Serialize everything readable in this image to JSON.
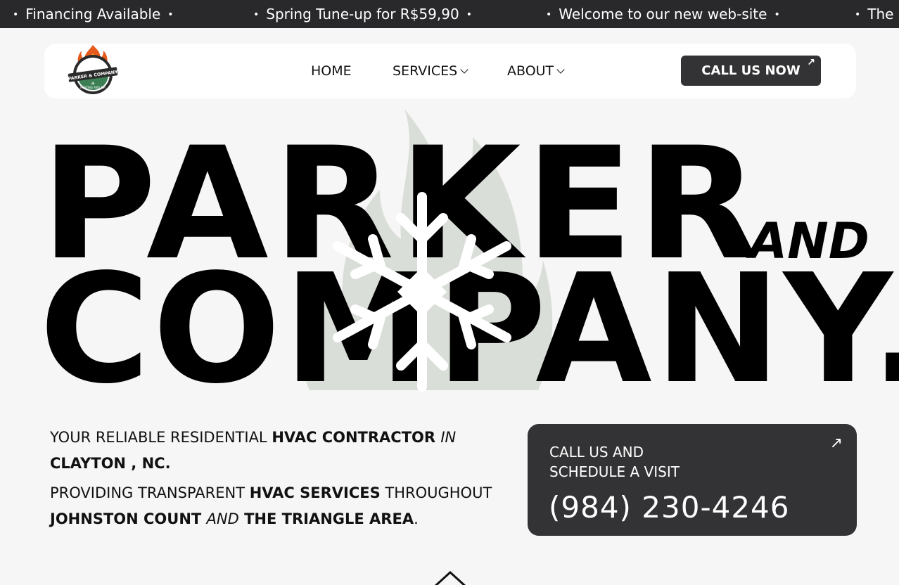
{
  "ticker": {
    "items": [
      "Financing Available",
      "Spring Tune-up for  R$59,90",
      "Welcome to our new web-site",
      "The b"
    ]
  },
  "logo": {
    "text": "PARKER & COMPANY",
    "subtext": "HEATING AND AIR"
  },
  "nav": {
    "home": "HOME",
    "services": "SERVICES",
    "about": "ABOUT",
    "cta": "CALL US NOW"
  },
  "hero": {
    "line1": "PARKER",
    "and": "AND",
    "line2": "COMPANY."
  },
  "tagline": {
    "p1": {
      "a": "YOUR RELIABLE RESIDENTIAL ",
      "b": "HVAC CONTRACTOR ",
      "c": "IN",
      "d": "CLAYTON , NC."
    },
    "p2": {
      "a": "PROVIDING TRANSPARENT ",
      "b": "HVAC SERVICES",
      "c": " THROUGHOUT ",
      "d": "JOHNSTON COUNT ",
      "e": "AND",
      "f": " THE TRIANGLE AREA",
      "g": "."
    }
  },
  "phone_card": {
    "line1": "CALL US AND",
    "line2": "SCHEDULE A VISIT",
    "number": "(984) 230-4246"
  },
  "colors": {
    "dark": "#333234",
    "ticker_bg": "#29282b",
    "page_bg": "#f6f6f6",
    "flame_ghost": "#d7dbd5"
  },
  "icons": [
    "flame-snowflake-logo-icon",
    "chevron-down-icon",
    "arrow-up-right-icon",
    "chevron-up-icon"
  ]
}
